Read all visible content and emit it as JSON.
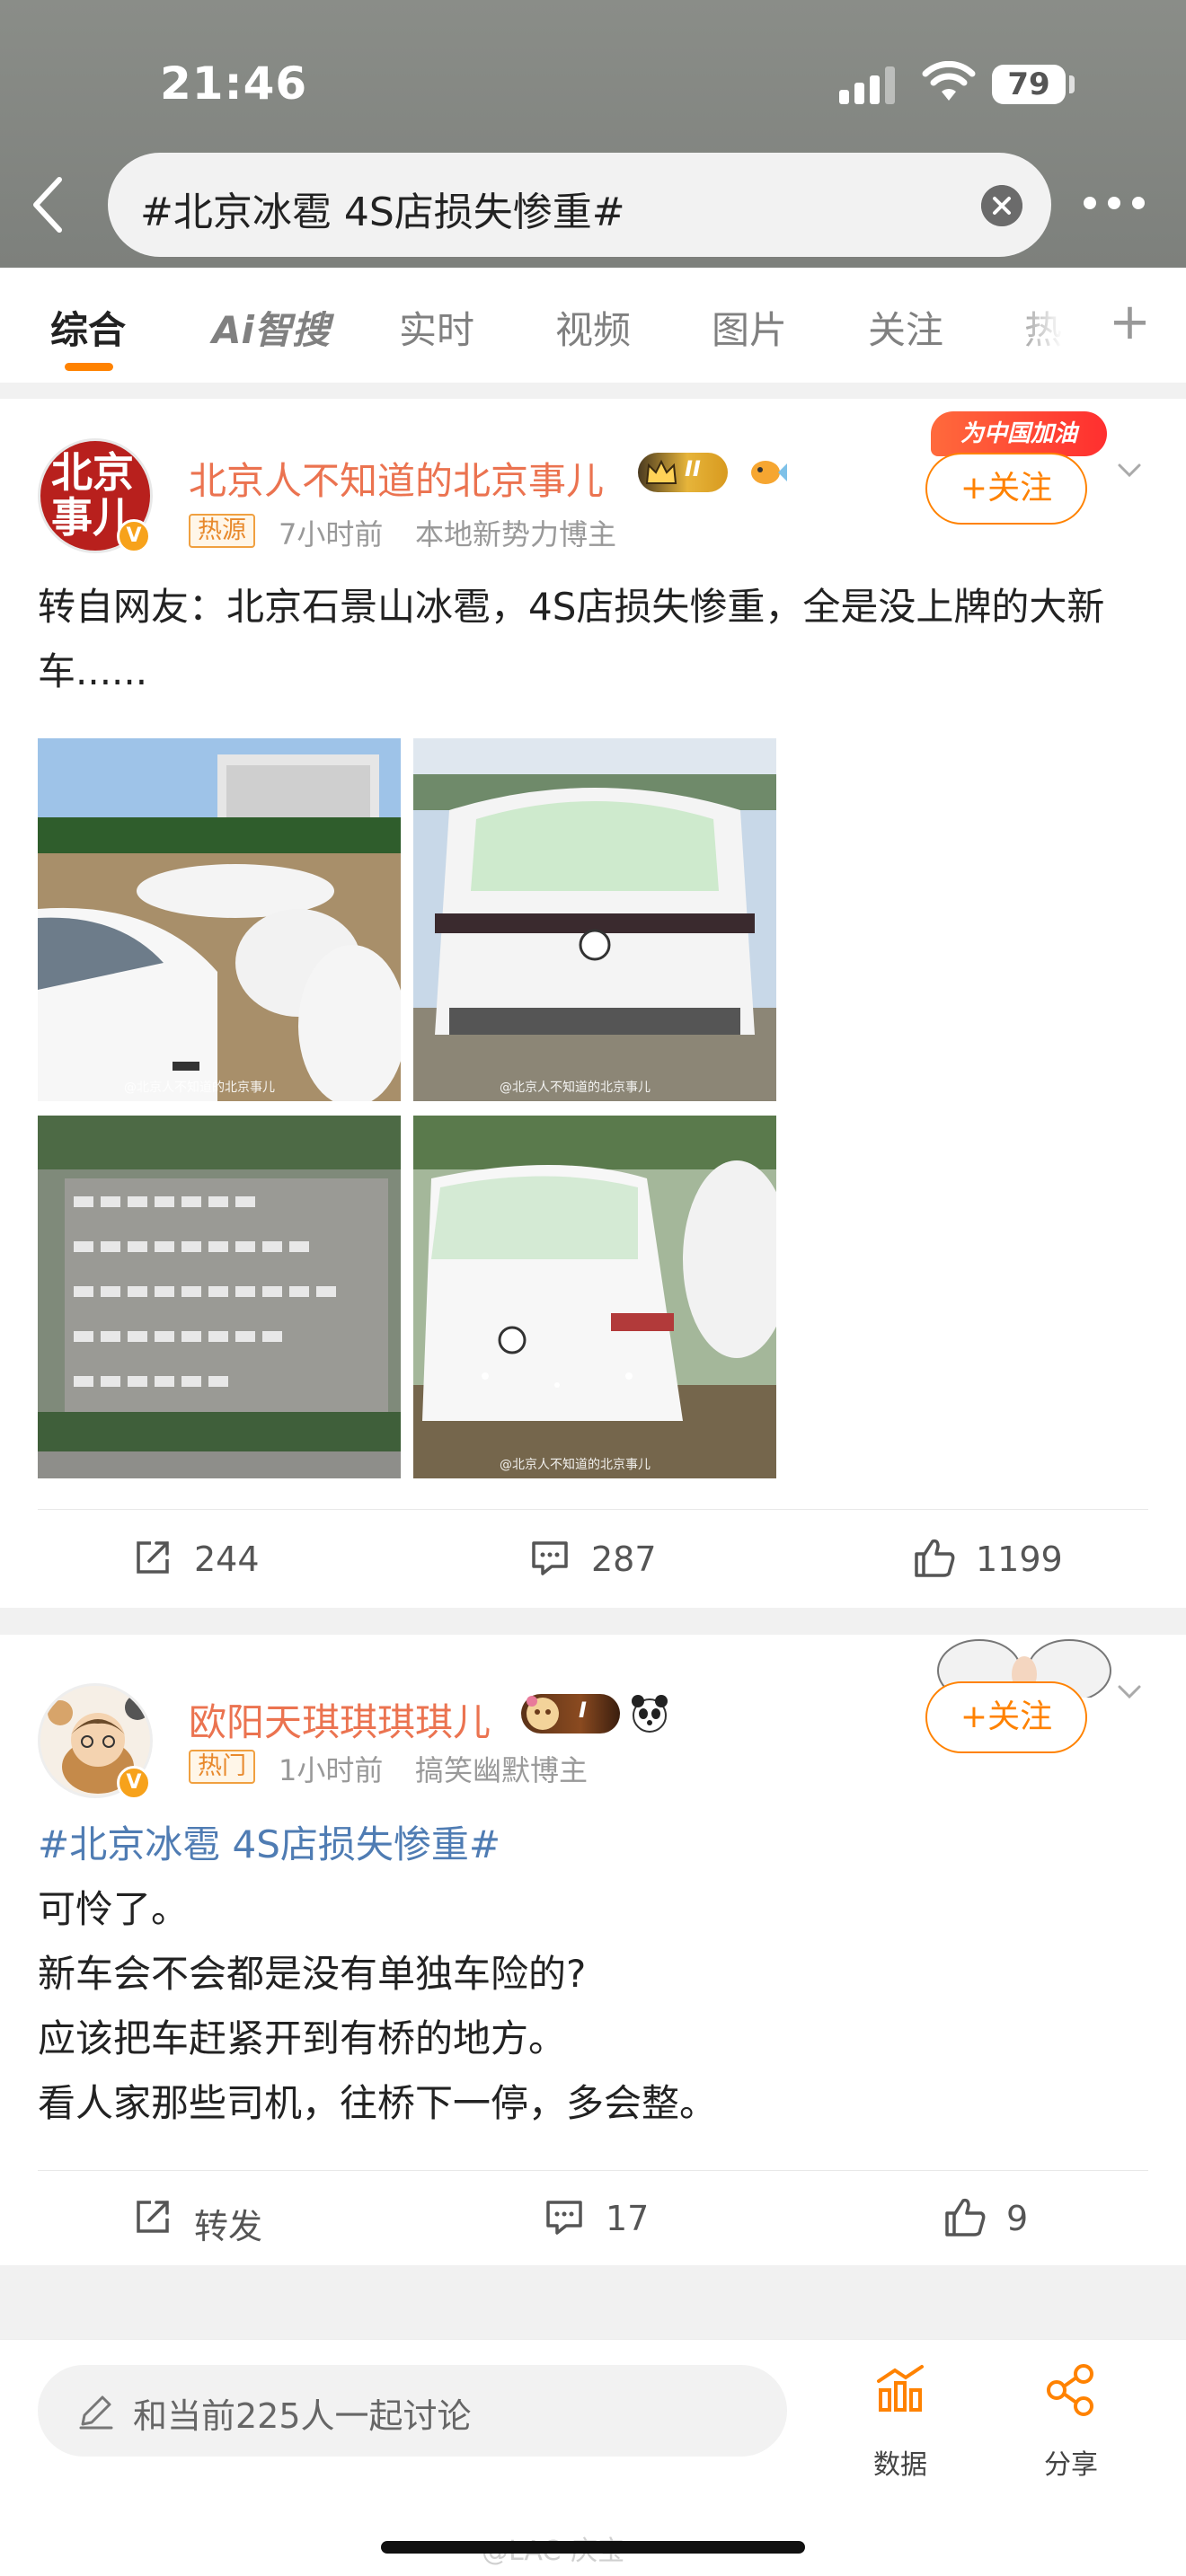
{
  "status_bar": {
    "time": "21:46",
    "battery": "79"
  },
  "search": {
    "query": "#北京冰雹 4S店损失惨重#"
  },
  "tabs": [
    {
      "label": "综合"
    },
    {
      "label": "Ai智搜"
    },
    {
      "label": "实时"
    },
    {
      "label": "视频"
    },
    {
      "label": "图片"
    },
    {
      "label": "关注"
    },
    {
      "label": "热"
    }
  ],
  "posts": [
    {
      "author": "北京人不知道的北京事儿",
      "avatar_text": "北京事儿",
      "level": "II",
      "tag": "热源",
      "time": "7小时前",
      "role": "本地新势力博主",
      "follow_badge": "为中国加油",
      "follow_label": "+关注",
      "text": "转自网友：北京石景山冰雹，4S店损失惨重，全是没上牌的大新车......",
      "image_watermark": "@北京人不知道的北京事儿",
      "repost": "244",
      "comments": "287",
      "likes": "1199"
    },
    {
      "author": "欧阳天琪琪琪琪儿",
      "level": "I",
      "tag": "热门",
      "time": "1小时前",
      "role": "搞笑幽默博主",
      "follow_label": "+关注",
      "hashtag": "#北京冰雹 4S店损失惨重#",
      "lines": [
        "可怜了。",
        "新车会不会都是没有单独车险的?",
        "应该把车赶紧开到有桥的地方。",
        "看人家那些司机，往桥下一停，多会整。"
      ],
      "repost": "转发",
      "comments": "17",
      "likes": "9"
    }
  ],
  "bottom_bar": {
    "discuss_placeholder": "和当前225人一起讨论",
    "data_label": "数据",
    "share_label": "分享",
    "watermark": "@LAC-庆宝"
  },
  "colors": {
    "accent": "#ff8200",
    "author": "#eb7350",
    "hashtag": "#4f7cb3"
  }
}
